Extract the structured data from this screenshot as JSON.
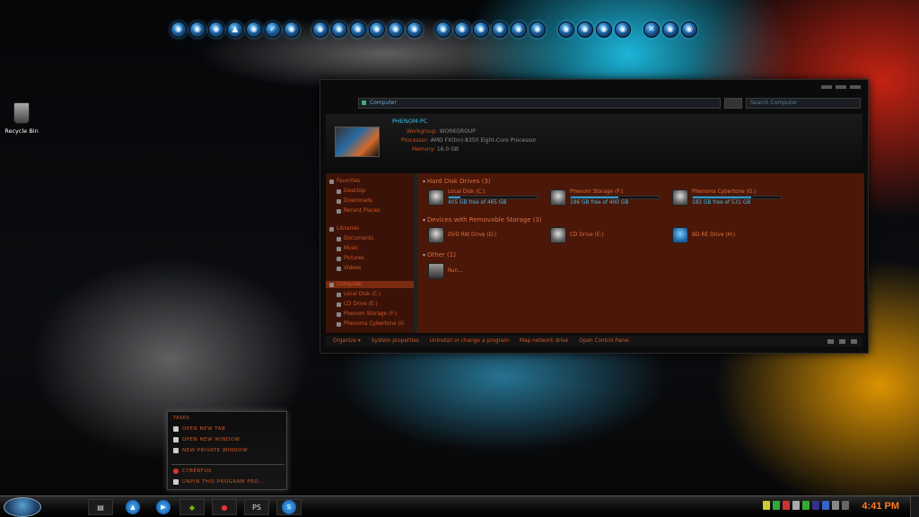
{
  "desktop": {
    "recycle_bin_label": "Recycle Bin"
  },
  "explorer": {
    "address": "Computer",
    "search_placeholder": "Search Computer",
    "computer_name": "PHENOM-PC",
    "workgroup_label": "Workgroup:",
    "workgroup_value": "WORKGROUP",
    "processor_label": "Processor:",
    "processor_value": "AMD FX(tm)-8350 Eight-Core Processor",
    "memory_label": "Memory:",
    "memory_value": "16.0 GB",
    "sidebar": {
      "favorites": "Favorites",
      "desktop": "Desktop",
      "downloads": "Downloads",
      "recent_places": "Recent Places",
      "libraries": "Libraries",
      "documents": "Documents",
      "music": "Music",
      "pictures": "Pictures",
      "videos": "Videos",
      "computer": "Computer",
      "local_disk": "Local Disk (C:)",
      "cd_drive": "CD Drive (E:)",
      "phenom_storage": "Phenom Storage (F:)",
      "phenoms_cybertone": "Phenoms Cybertone (G"
    },
    "groups": {
      "hard_disk": "Hard Disk Drives (3)",
      "removable": "Devices with Removable Storage (3)",
      "other": "Other (1)"
    },
    "drives": [
      {
        "name": "Local Disk (C:)",
        "free": "405 GB free of 465 GB",
        "used_fraction": 0.13
      },
      {
        "name": "Phenom Storage (F:)",
        "free": "186 GB free of 400 GB",
        "used_fraction": 0.54
      },
      {
        "name": "Phenoms Cybertone (G:)",
        "free": "182 GB free of 531 GB",
        "used_fraction": 0.66
      }
    ],
    "removable": [
      {
        "name": "DVD RW Drive (D:)"
      },
      {
        "name": "CD Drive (E:)"
      },
      {
        "name": "BD-RE Drive (H:)"
      }
    ],
    "other": [
      {
        "name": "Run..."
      }
    ],
    "commands": {
      "organize": "Organize ▾",
      "system_properties": "System properties",
      "uninstall": "Uninstall or change a program",
      "map_drive": "Map network drive",
      "control_panel": "Open Control Panel"
    }
  },
  "jumplist": {
    "header": "TASKS",
    "new_tab": "OPEN NEW TAB",
    "new_window": "OPEN NEW WINDOW",
    "new_private": "NEW PRIVATE WINDOW",
    "cyberfox": "CYBERFOX",
    "unpin": "UNPIN THIS PROGRAM FRO..."
  },
  "taskbar": {
    "ps_label": "PS",
    "clock": "4:41 PM"
  }
}
